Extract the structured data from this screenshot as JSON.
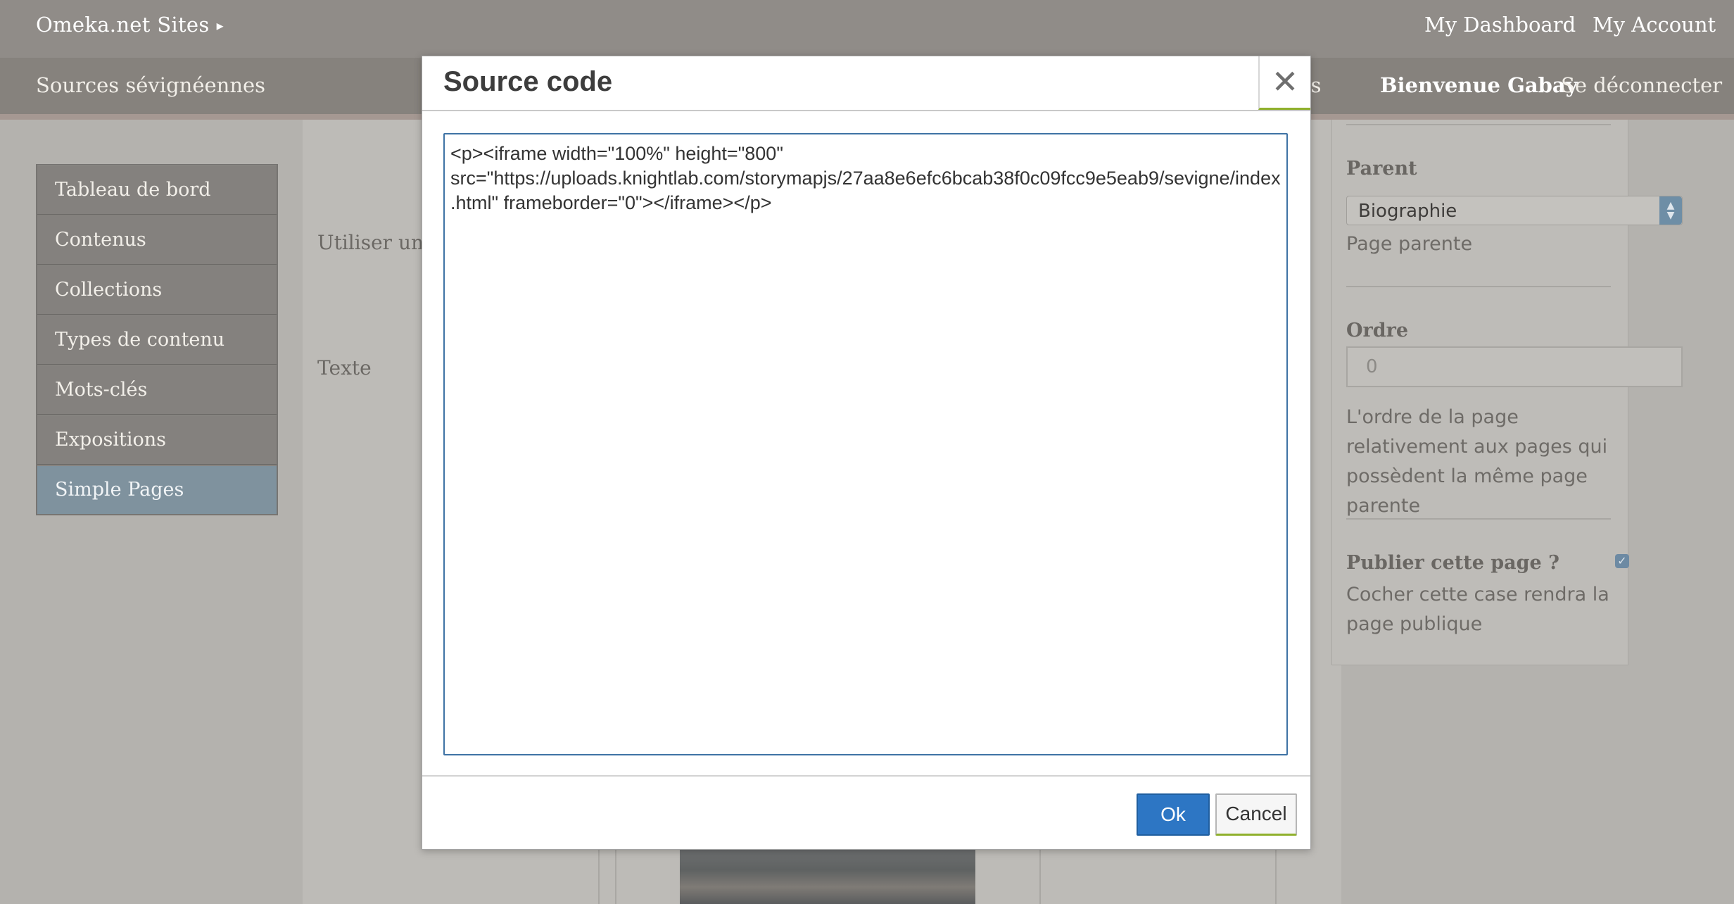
{
  "topbar": {
    "site_title": "Omeka.net Sites",
    "dashboard_link": "My Dashboard",
    "account_link": "My Account"
  },
  "subbar": {
    "site_name": "Sources sévignéennes",
    "partial_link": "tres",
    "welcome": "Bienvenue Gabay",
    "logout": "Se déconnecter"
  },
  "sidenav": {
    "items": [
      {
        "label": "Tableau de bord"
      },
      {
        "label": "Contenus"
      },
      {
        "label": "Collections"
      },
      {
        "label": "Types de contenu"
      },
      {
        "label": "Mots-clés"
      },
      {
        "label": "Expositions"
      },
      {
        "label": "Simple Pages"
      }
    ],
    "active_index": 6
  },
  "main": {
    "use_editor_label": "Utiliser un éditeur HTML ?",
    "text_label": "Texte"
  },
  "right_panel": {
    "parent_label": "Parent",
    "parent_value": "Biographie",
    "parent_help": "Page parente",
    "order_label": "Ordre",
    "order_value": "0",
    "order_help": "L'ordre de la page relativement aux pages qui possèdent la même page parente",
    "publish_label": "Publier cette page ?",
    "publish_checked": true,
    "publish_help": "Cocher cette case rendra la page publique"
  },
  "modal": {
    "title": "Source code",
    "close_icon": "close-icon",
    "code": "<p><iframe width=\"100%\" height=\"800\" src=\"https://uploads.knightlab.com/storymapjs/27aa8e6efc6bcab38f0c09fcc9e5eab9/sevigne/index.html\" frameborder=\"0\"></iframe></p>",
    "ok_label": "Ok",
    "cancel_label": "Cancel"
  },
  "colors": {
    "ok_button": "#2d76c4",
    "focus_border": "#3f73a5",
    "active_nav": "#7f929e",
    "accent_underline": "#8fb02c"
  }
}
